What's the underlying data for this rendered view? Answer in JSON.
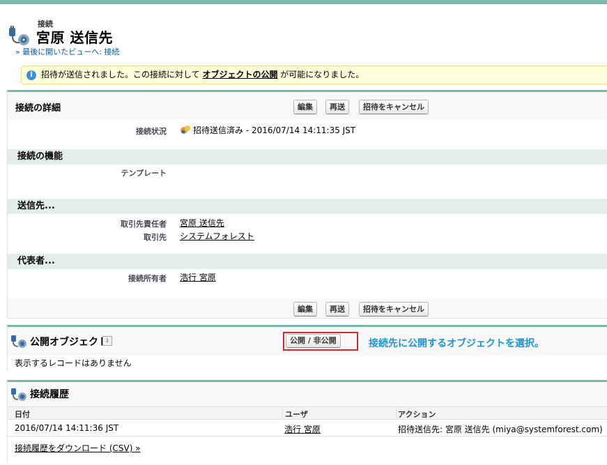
{
  "record": {
    "object_type": "接続",
    "title": "宮原 送信先",
    "back_link_prefix": "» ",
    "back_link": "最後に開いたビューへ: 接続"
  },
  "info_message": {
    "before": "招待が送信されました。この接続に対して ",
    "link": "オブジェクトの公開",
    "after": " が可能になりました。"
  },
  "detail": {
    "title": "接続の詳細",
    "buttons": {
      "edit": "編集",
      "resend": "再送",
      "cancel_invite": "招待をキャンセル"
    },
    "status_label": "接続状況",
    "status_value": "招待送信済み - 2016/07/14 14:11:35 JST",
    "sections": {
      "features": "接続の機能",
      "destination": "送信先...",
      "representative": "代表者..."
    },
    "template_label": "テンプレート",
    "contact_label": "取引先責任者",
    "contact_value": "宮原 送信先",
    "account_label": "取引先",
    "account_value": "システムフォレスト",
    "owner_label": "接続所有者",
    "owner_value": "浩行 宮原"
  },
  "published_objects": {
    "title": "公開オブジェクト",
    "help": "i",
    "publish_button": "公開 / 非公開",
    "callout": "接続先に公開するオブジェクトを選択。",
    "empty": "表示するレコードはありません"
  },
  "history": {
    "title": "接続履歴",
    "columns": [
      "日付",
      "ユーザ",
      "アクション"
    ],
    "rows": [
      {
        "date": "2016/07/14 14:11:36 JST",
        "user": "浩行 宮原",
        "action": "招待送信先: 宮原 送信先 (miya@systemforest.com)"
      }
    ],
    "download_link": "接続履歴をダウンロード (CSV) »"
  },
  "colors": {
    "accent": "#7ab8a8",
    "section_bg": "#e3ede9",
    "callout": "#1a96d8",
    "highlight_box": "#d9262e"
  },
  "icons": {
    "header": "connection-plug-icon",
    "status": "invite-sent-icon",
    "info": "info-icon",
    "help": "help-icon"
  }
}
